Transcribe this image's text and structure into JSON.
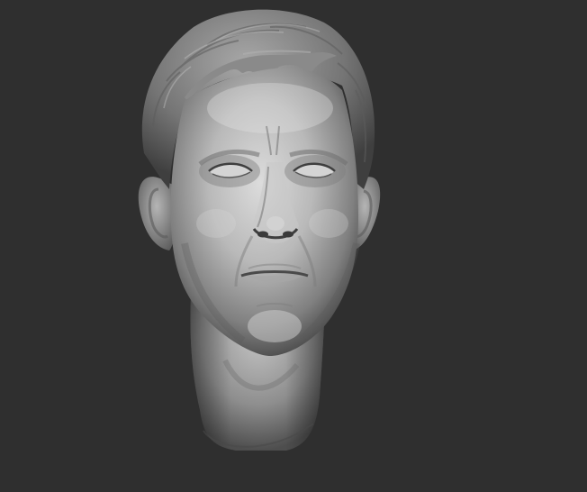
{
  "viewport": {
    "background_color": "#2f2f2f",
    "subject": "sculpted-male-head",
    "material_colors": {
      "highlight": "#d9d9d9",
      "midtone": "#9a9a9a",
      "shadow": "#3c3c3c"
    }
  }
}
